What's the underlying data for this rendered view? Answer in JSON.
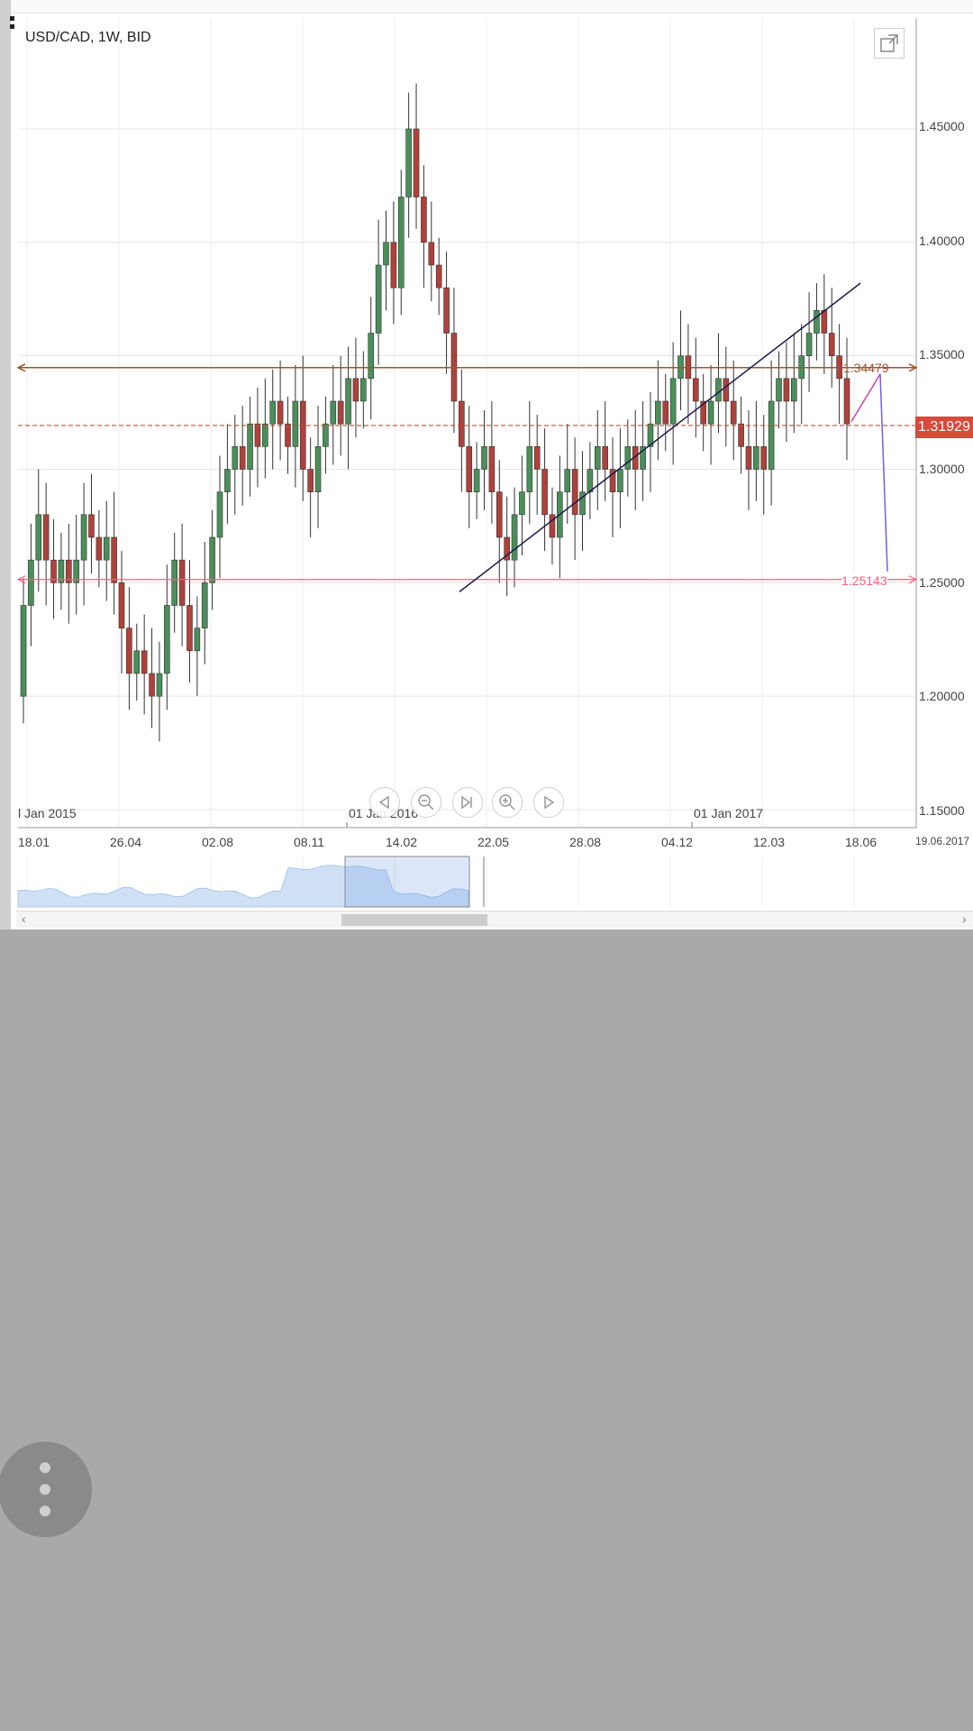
{
  "chart_data": {
    "type": "candlestick",
    "title": "USD/CAD, 1W, BID",
    "ylim": [
      1.15,
      1.47
    ],
    "y_ticks": [
      "1.45000",
      "1.40000",
      "1.35000",
      "1.30000",
      "1.25000",
      "1.20000",
      "1.15000"
    ],
    "x_ticks": [
      "18.01",
      "26.04",
      "02.08",
      "08.11",
      "14.02",
      "22.05",
      "28.08",
      "04.12",
      "12.03",
      "18.06",
      "19.06.2017"
    ],
    "year_labels": [
      "l Jan 2015",
      "01 Jan 2016",
      "01 Jan 2017"
    ],
    "current_price": "1.31929",
    "resistance_level": "1.34479",
    "support_level": "1.25143",
    "closes": [
      1.24,
      1.26,
      1.28,
      1.26,
      1.25,
      1.26,
      1.25,
      1.26,
      1.28,
      1.27,
      1.26,
      1.27,
      1.25,
      1.23,
      1.21,
      1.22,
      1.21,
      1.2,
      1.21,
      1.24,
      1.26,
      1.24,
      1.22,
      1.23,
      1.25,
      1.27,
      1.29,
      1.3,
      1.31,
      1.3,
      1.32,
      1.31,
      1.32,
      1.33,
      1.32,
      1.31,
      1.33,
      1.3,
      1.29,
      1.31,
      1.32,
      1.33,
      1.32,
      1.34,
      1.33,
      1.34,
      1.36,
      1.39,
      1.4,
      1.38,
      1.42,
      1.45,
      1.42,
      1.4,
      1.39,
      1.38,
      1.36,
      1.33,
      1.31,
      1.29,
      1.3,
      1.31,
      1.29,
      1.27,
      1.26,
      1.28,
      1.29,
      1.31,
      1.3,
      1.28,
      1.27,
      1.29,
      1.3,
      1.28,
      1.29,
      1.3,
      1.31,
      1.3,
      1.29,
      1.3,
      1.31,
      1.3,
      1.31,
      1.32,
      1.33,
      1.32,
      1.34,
      1.35,
      1.34,
      1.33,
      1.32,
      1.33,
      1.34,
      1.33,
      1.32,
      1.31,
      1.3,
      1.31,
      1.3,
      1.33,
      1.34,
      1.33,
      1.34,
      1.35,
      1.36,
      1.37,
      1.36,
      1.35,
      1.34,
      1.32
    ],
    "grid": true
  },
  "controls": {
    "nav": [
      "back-icon",
      "zoom-out-icon",
      "skip-end-icon",
      "zoom-in-icon",
      "play-icon"
    ]
  },
  "colors": {
    "bull": "#4a8f5a",
    "bear": "#b0413a",
    "resistance": "#a0552a",
    "support": "#ff5a7a",
    "current": "#e04030",
    "trendline": "#1a1a4a",
    "projection1": "#cc44aa",
    "projection2": "#7a5af0"
  }
}
